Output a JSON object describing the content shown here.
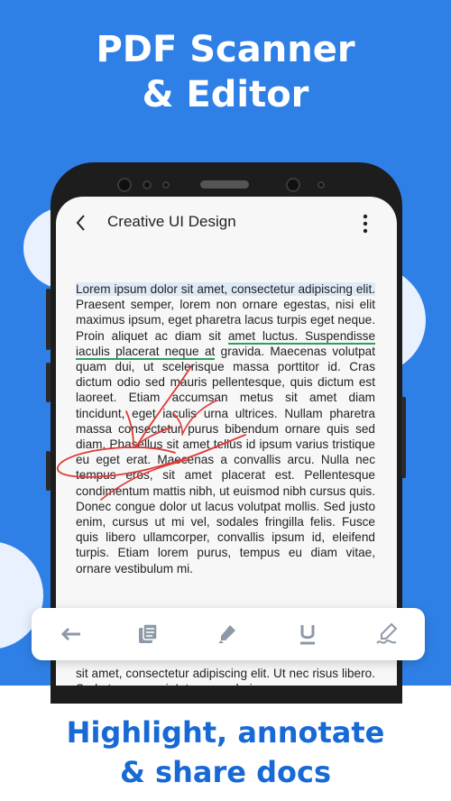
{
  "hero": {
    "line1": "PDF Scanner",
    "line2": "& Editor"
  },
  "app": {
    "title": "Creative UI Design"
  },
  "document": {
    "highlighted_1": "Lorem ipsum dolor sit amet, consectetur adipiscing elit.",
    "text_1": " Praesent semper, lorem non ornare egestas, nisi elit maximus ipsum, eget pharetra lacus turpis eget neque. Proin aliquet ac diam sit ",
    "underlined": "amet luctus. Suspendisse iaculis placerat neque at",
    "text_2": " gravida. Maecenas volutpat quam dui, ut scelerisque massa porttitor id. Cras dictum odio sed mauris pellentesque, quis dictum est laoreet. Etiam accumsan metus sit amet diam tincidunt, eget iaculis urna ultrices. Nullam pharetra massa consectetur purus bibendum ornare quis sed diam. Phasellus sit amet tellus id ipsum varius tristique eu eget erat. Maecenas a convallis arcu. Nulla nec tempus eros, sit amet placerat est. Pellentesque condimentum mattis nibh, ut euismod nibh cursus quis. Donec congue dolor ut lacus volutpat mollis. Sed justo enim, cursus ut mi vel, sodales fringilla felis. Fusce quis libero ullamcorper, convallis ipsum id, eleifend turpis. Etiam lorem purus, tempus eu diam vitae, ornare vestibulum mi.",
    "lower_text": "sit amet, consectetur adipiscing elit. Ut nec risus libero. Sed ut purus orci. Integer scelerisque neque"
  },
  "toolbar": {
    "tools": [
      {
        "name": "back-arrow-icon"
      },
      {
        "name": "copy-pages-icon"
      },
      {
        "name": "highlighter-icon"
      },
      {
        "name": "underline-icon"
      },
      {
        "name": "signature-pen-icon"
      }
    ]
  },
  "tagline": {
    "line1": "Highlight, annotate",
    "line2": "& share docs"
  },
  "colors": {
    "background": "#2f80e6",
    "accent_text": "#1769d6",
    "highlight": "#dfeaf6",
    "underline": "#2e9e5b",
    "annotation": "#e03a3a"
  }
}
